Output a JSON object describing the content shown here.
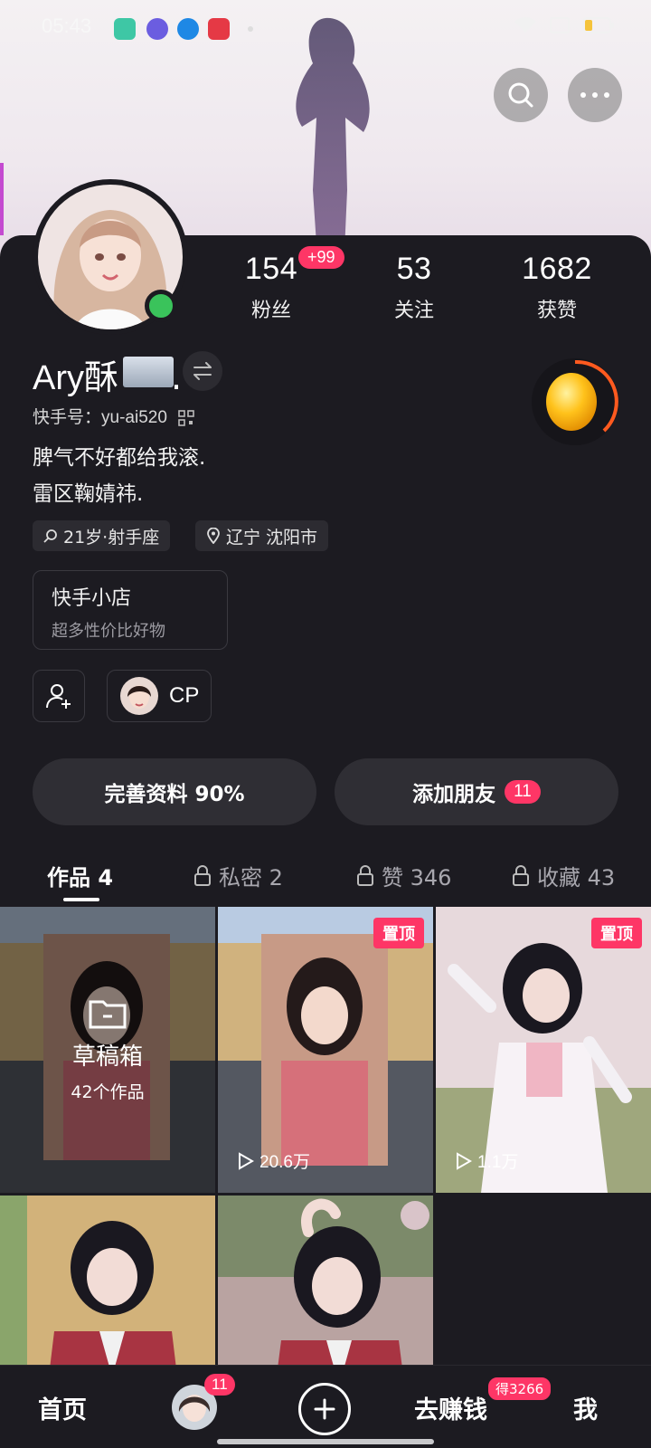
{
  "status": {
    "time": "05:43"
  },
  "profile": {
    "name": "Ary酥",
    "name_suffix": ".",
    "kuaishou_id_label": "快手号：",
    "kuaishou_id": "yu-ai520",
    "bio_lines": [
      "脾气不好都给我滚.",
      "雷区鞠婧祎."
    ],
    "age_zodiac": "21岁·射手座",
    "location": "辽宁 沈阳市"
  },
  "stats": [
    {
      "value": "154",
      "label": "粉丝"
    },
    {
      "value": "53",
      "label": "关注"
    },
    {
      "value": "1682",
      "label": "获赞"
    }
  ],
  "fans_new_badge": "+99",
  "shop": {
    "title": "快手小店",
    "subtitle": "超多性价比好物"
  },
  "cp_label": "CP",
  "actions": {
    "complete_profile": "完善资料 90%",
    "add_friends": "添加朋友",
    "add_friends_count": "11"
  },
  "tabs": [
    {
      "label": "作品 4",
      "locked": false,
      "active": true
    },
    {
      "label": "私密 2",
      "locked": true,
      "active": false
    },
    {
      "label": "赞 346",
      "locked": true,
      "active": false
    },
    {
      "label": "收藏 43",
      "locked": true,
      "active": false
    }
  ],
  "works": {
    "draft_title": "草稿箱",
    "draft_count": "42个作品",
    "pin_label": "置顶",
    "video1_plays": "20.6万",
    "video2_plays": "1.1万"
  },
  "bottom_nav": {
    "home": "首页",
    "messages_badge": "11",
    "earn": "去赚钱",
    "earn_badge": "得3266",
    "me": "我"
  },
  "colors": {
    "accent": "#fe3666",
    "background": "#1c1b21",
    "online": "#3ac35b"
  }
}
